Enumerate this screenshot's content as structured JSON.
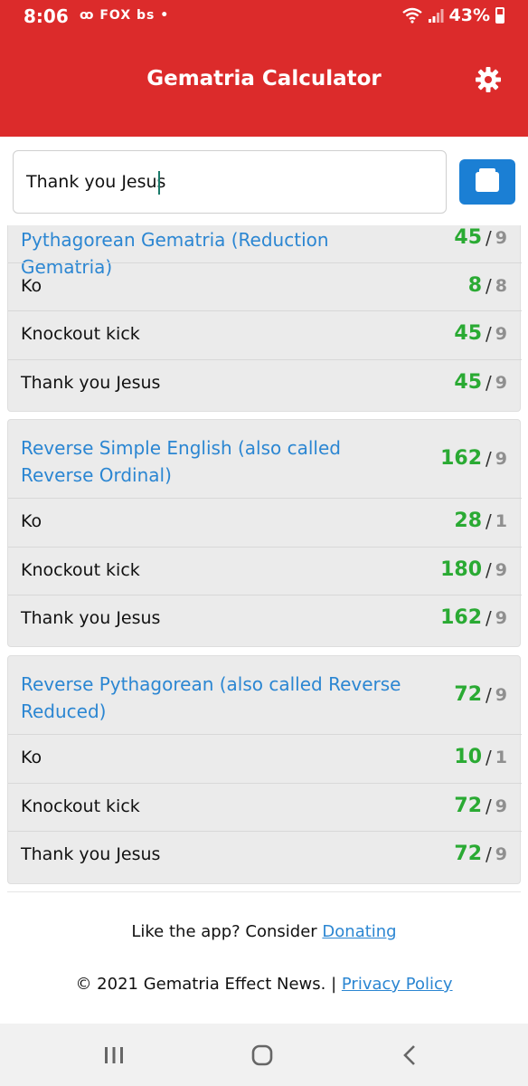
{
  "status": {
    "time": "8:06",
    "notifications": "ꝏ FOX bs •",
    "battery": "43%"
  },
  "appbar": {
    "title": "Gematria Calculator",
    "settings_icon": "gear-icon"
  },
  "search": {
    "value": "Thank you Jesus",
    "button_icon": "calculator-icon"
  },
  "cards": [
    {
      "title": "Pythagorean Gematria (Reduction Gematria)",
      "total": "45",
      "reduced": "9",
      "rows": [
        {
          "word": "Ko",
          "value": "8",
          "reduced": "8"
        },
        {
          "word": "Knockout kick",
          "value": "45",
          "reduced": "9"
        },
        {
          "word": "Thank you Jesus",
          "value": "45",
          "reduced": "9"
        }
      ]
    },
    {
      "title": "Reverse Simple English (also called Reverse Ordinal)",
      "total": "162",
      "reduced": "9",
      "rows": [
        {
          "word": "Ko",
          "value": "28",
          "reduced": "1"
        },
        {
          "word": "Knockout kick",
          "value": "180",
          "reduced": "9"
        },
        {
          "word": "Thank you Jesus",
          "value": "162",
          "reduced": "9"
        }
      ]
    },
    {
      "title": "Reverse Pythagorean (also called Reverse Reduced)",
      "total": "72",
      "reduced": "9",
      "rows": [
        {
          "word": "Ko",
          "value": "10",
          "reduced": "1"
        },
        {
          "word": "Knockout kick",
          "value": "72",
          "reduced": "9"
        },
        {
          "word": "Thank you Jesus",
          "value": "72",
          "reduced": "9"
        }
      ]
    }
  ],
  "footer": {
    "donate_prefix": "Like the app? Consider ",
    "donate_link": "Donating",
    "copyright": "© 2021 Gematria Effect News. | ",
    "privacy_link": "Privacy Policy"
  },
  "navbar": {
    "recents_icon": "recents-icon",
    "home_icon": "home-icon",
    "back_icon": "back-icon"
  },
  "colors": {
    "brand": "#dc2b2b",
    "accent": "#1b7fd4",
    "value": "#2aaa33",
    "link": "#2b86d2"
  }
}
